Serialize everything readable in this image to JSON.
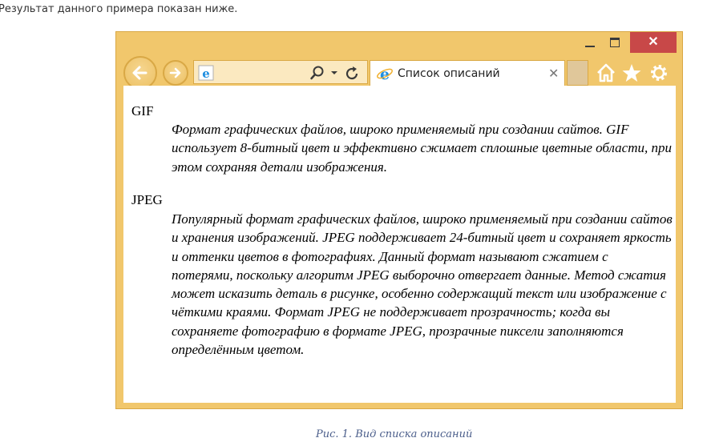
{
  "intro_text": "Результат данного примера показан ниже.",
  "browser": {
    "window_controls": {
      "minimize_icon": "minimize-icon",
      "maximize_icon": "maximize-icon",
      "close_glyph": "✕"
    },
    "nav": {
      "back_icon": "arrow-left-icon",
      "forward_icon": "arrow-right-icon"
    },
    "address_bar": {
      "value": "",
      "page_icon": "ie-logo-icon",
      "search_icon": "search-icon",
      "dropdown_icon": "chevron-down-icon",
      "refresh_icon": "refresh-icon"
    },
    "tab": {
      "title": "Список описаний",
      "close_glyph": "✕",
      "icon": "ie-logo-icon"
    },
    "toolbar_icons": [
      "home-icon",
      "star-icon",
      "gear-icon"
    ],
    "colors": {
      "frame": "#f1c76c",
      "close_button": "#c84848",
      "ie_blue": "#1f8ee0"
    }
  },
  "page": {
    "definitions": [
      {
        "term": "GIF",
        "description": "Формат графических файлов, широко применяемый при создании сайтов. GIF использует 8-битный цвет и эффективно сжимает сплошные цветные области, при этом сохраняя детали изображения."
      },
      {
        "term": "JPEG",
        "description": "Популярный формат графических файлов, широко применяемый при создании сайтов и хранения изображений. JPEG поддерживает 24-битный цвет и сохраняет яркость и оттенки цветов в фотографиях. Данный формат называют сжатием с потерями, поскольку алгоритм JPEG выборочно отвергает данные. Метод сжатия может исказить деталь в рисунке, особенно содержащий текст или изображение с чёткими краями. Формат JPEG не поддерживает прозрачность; когда вы сохраняете фотографию в формате JPEG, прозрачные пиксели заполняются определённым цветом."
      }
    ]
  },
  "caption": "Рис. 1. Вид списка описаний"
}
